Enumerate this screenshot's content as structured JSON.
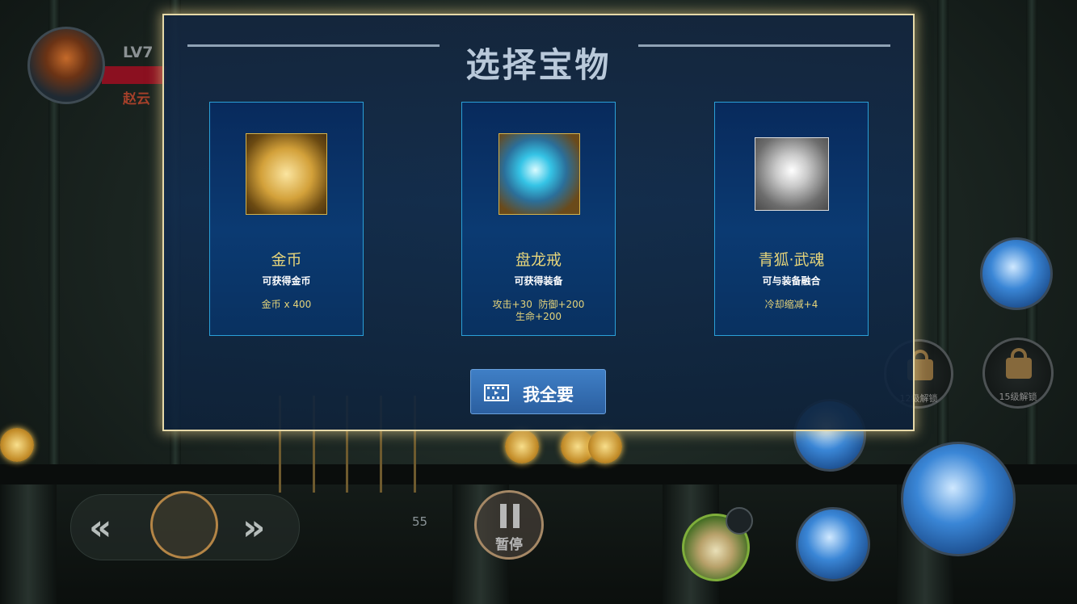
{
  "player": {
    "level": "LV7",
    "name": "赵云"
  },
  "dialog": {
    "title": "选择宝物",
    "cards": [
      {
        "name": "金币",
        "desc": "可获得金币",
        "stats": [
          "金币 x 400"
        ],
        "icon": "gold-coin-icon"
      },
      {
        "name": "盘龙戒",
        "desc": "可获得装备",
        "stats": [
          "攻击+30  防御+200",
          "生命+200"
        ],
        "icon": "dragon-ring-icon"
      },
      {
        "name": "青狐·武魂",
        "desc": "可与装备融合",
        "stats": [
          "冷却缩减+4"
        ],
        "icon": "fox-soul-icon"
      }
    ],
    "take_all_label": "我全要"
  },
  "hud": {
    "score": "55",
    "pause_label": "暂停",
    "locks": [
      "12级解锁",
      "15级解锁"
    ]
  },
  "colors": {
    "card_name": "#e4d37a",
    "dialog_border": "#e6d9a8",
    "button": "#2b5fa0"
  }
}
